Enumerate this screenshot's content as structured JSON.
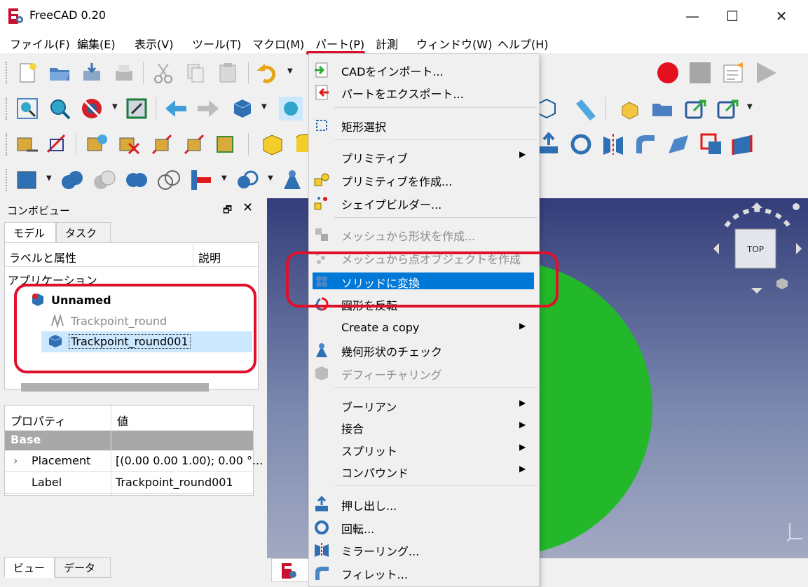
{
  "window": {
    "title": "FreeCAD 0.20",
    "minimize": "—",
    "maximize": "☐",
    "close": "✕"
  },
  "menubar": {
    "items": [
      "ファイル(F)",
      "編集(E)",
      "表示(V)",
      "ツール(T)",
      "マクロ(M)",
      "パート(P)",
      "計測",
      "ウィンドウ(W)",
      "ヘルプ(H)"
    ]
  },
  "toolbar": {
    "more": "»"
  },
  "combo_view": {
    "title": "コンボビュー",
    "float": "🗗",
    "close": "✕",
    "tabs": [
      "モデル",
      "タスク"
    ],
    "tree_columns": [
      "ラベルと属性",
      "説明"
    ],
    "app_label": "アプリケーション",
    "doc_name": "Unnamed",
    "items": [
      "Trackpoint_round",
      "Trackpoint_round001"
    ],
    "property_columns": [
      "プロパティ",
      "値"
    ],
    "group": "Base",
    "properties": [
      {
        "name": "Placement",
        "value": "[(0.00 0.00 1.00); 0.00 °..."
      },
      {
        "name": "Label",
        "value": "Trackpoint_round001"
      }
    ],
    "bottom_tabs": [
      "ビュー",
      "データ"
    ]
  },
  "navcube": {
    "face": "TOP"
  },
  "part_menu": {
    "items": [
      {
        "label": "CADをインポート...",
        "icon": "import-icon"
      },
      {
        "label": "パートをエクスポート...",
        "icon": "export-icon"
      },
      {
        "label": "矩形選択",
        "icon": "box-select-icon"
      },
      {
        "label": "プリミティブ",
        "submenu": "▶"
      },
      {
        "label": "プリミティブを作成...",
        "icon": "primitives-icon"
      },
      {
        "label": "シェイプビルダー...",
        "icon": "shapebuilder-icon"
      },
      {
        "label": "メッシュから形状を作成...",
        "icon": "mesh-shape-icon"
      },
      {
        "label": "メッシュから点オブジェクトを作成",
        "icon": "mesh-points-icon"
      },
      {
        "label": "ソリッドに変換",
        "icon": "solid-icon"
      },
      {
        "label": "図形を反転",
        "icon": "reverse-icon"
      },
      {
        "label": "Create a copy",
        "submenu": "▶"
      },
      {
        "label": "幾何形状のチェック",
        "icon": "check-geometry-icon"
      },
      {
        "label": "デフィーチャリング",
        "icon": "defeaturing-icon"
      },
      {
        "label": "ブーリアン",
        "submenu": "▶"
      },
      {
        "label": "接合",
        "submenu": "▶"
      },
      {
        "label": "スプリット",
        "submenu": "▶"
      },
      {
        "label": "コンパウンド",
        "submenu": "▶"
      },
      {
        "label": "押し出し...",
        "icon": "extrude-icon"
      },
      {
        "label": "回転...",
        "icon": "revolve-icon"
      },
      {
        "label": "ミラーリング...",
        "icon": "mirror-icon"
      },
      {
        "label": "フィレット...",
        "icon": "fillet-icon"
      }
    ]
  },
  "colors": {
    "highlight": "#0078d7",
    "annotation_red": "#e0102b",
    "sphere_green": "#22b82a"
  }
}
